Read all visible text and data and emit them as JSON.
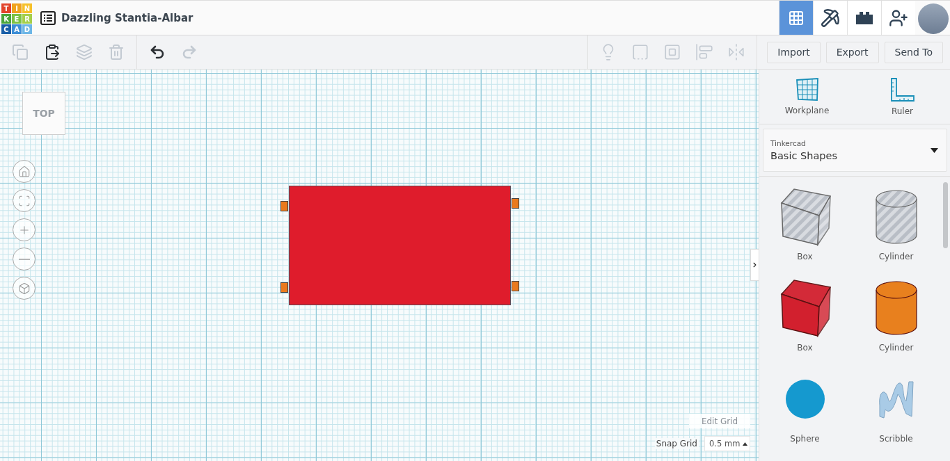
{
  "logo": [
    {
      "letter": "T",
      "color": "#e2432a"
    },
    {
      "letter": "I",
      "color": "#f0a21c"
    },
    {
      "letter": "N",
      "color": "#f6c02a"
    },
    {
      "letter": "K",
      "color": "#4aa53a"
    },
    {
      "letter": "E",
      "color": "#7cc242"
    },
    {
      "letter": "R",
      "color": "#a5cf4a"
    },
    {
      "letter": "C",
      "color": "#1a5fa8"
    },
    {
      "letter": "A",
      "color": "#3d8ed6"
    },
    {
      "letter": "D",
      "color": "#6db6e6"
    }
  ],
  "title": "Dazzling Stantia-Albar",
  "nav": [
    {
      "kind": "grid",
      "selected": true
    },
    {
      "kind": "pickaxe",
      "selected": false
    },
    {
      "kind": "brick",
      "selected": false
    },
    {
      "kind": "add-user",
      "selected": false
    }
  ],
  "toolbar_left": [
    {
      "kind": "copy",
      "disabled": true
    },
    {
      "kind": "paste",
      "disabled": false
    },
    {
      "kind": "duplicate",
      "disabled": true
    },
    {
      "kind": "delete",
      "disabled": true
    }
  ],
  "history": [
    {
      "kind": "undo",
      "disabled": false
    },
    {
      "kind": "redo",
      "disabled": true
    }
  ],
  "toolbar_right": [
    {
      "kind": "note",
      "disabled": true
    },
    {
      "kind": "group",
      "disabled": true
    },
    {
      "kind": "hole",
      "disabled": true
    },
    {
      "kind": "align",
      "disabled": true
    },
    {
      "kind": "mirror",
      "disabled": true
    }
  ],
  "actions": [
    "Import",
    "Export",
    "Send To"
  ],
  "view_cube": "TOP",
  "view_controls": [
    {
      "kind": "home"
    },
    {
      "kind": "fit"
    },
    {
      "kind": "zoom-in"
    },
    {
      "kind": "zoom-out"
    },
    {
      "kind": "perspective"
    }
  ],
  "edit_grid": "Edit Grid",
  "snap_grid": {
    "label": "Snap Grid",
    "value": "0.5 mm"
  },
  "tools": [
    {
      "kind": "workplane",
      "label": "Workplane"
    },
    {
      "kind": "ruler",
      "label": "Ruler"
    }
  ],
  "library": {
    "label": "Tinkercad",
    "value": "Basic Shapes"
  },
  "shapes": [
    {
      "kind": "box",
      "label": "Box",
      "hole": true,
      "color": "#b8bdc4"
    },
    {
      "kind": "cylinder",
      "label": "Cylinder",
      "hole": true,
      "color": "#b8bdc4"
    },
    {
      "kind": "box",
      "label": "Box",
      "hole": false,
      "color": "#d2202e"
    },
    {
      "kind": "cylinder",
      "label": "Cylinder",
      "hole": false,
      "color": "#e8801e"
    },
    {
      "kind": "sphere",
      "label": "Sphere",
      "hole": false,
      "color": "#1599cf"
    },
    {
      "kind": "scribble",
      "label": "Scribble",
      "hole": false,
      "color": "#a9cbe6"
    }
  ]
}
